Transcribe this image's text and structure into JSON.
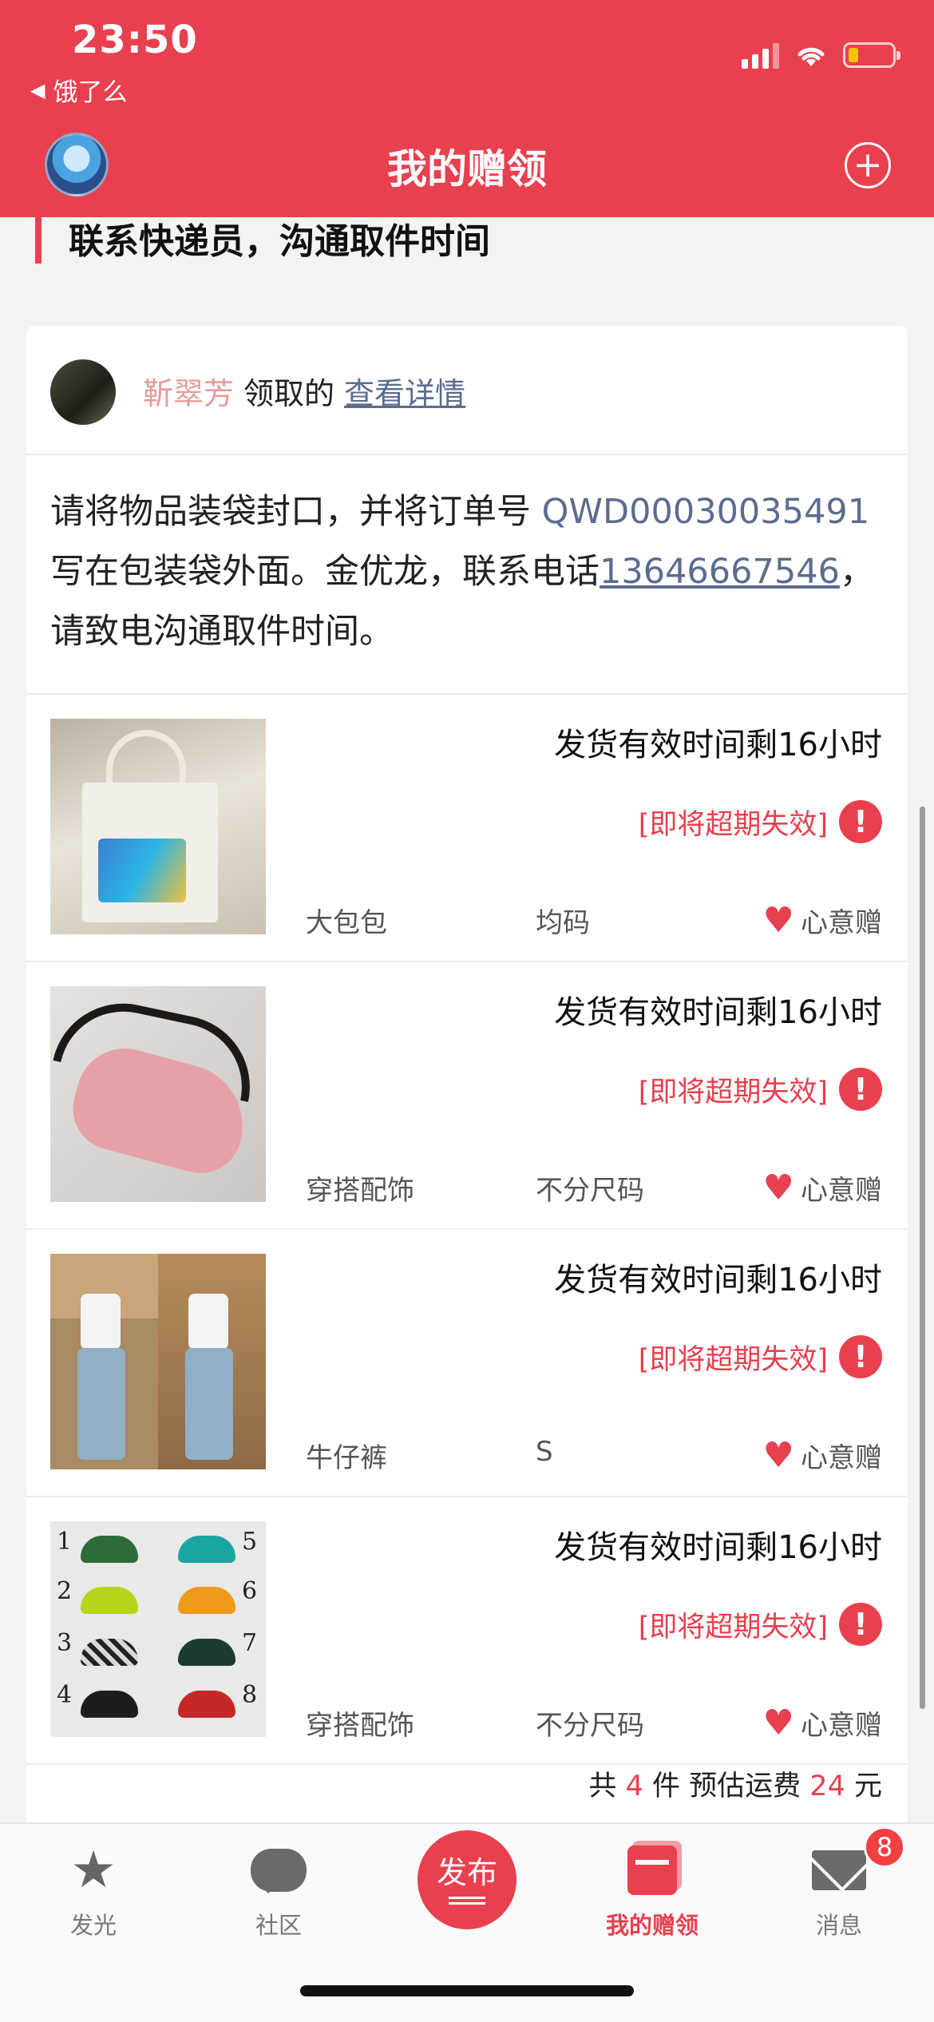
{
  "status_bar": {
    "time": "23:50",
    "back_app": "饿了么"
  },
  "header": {
    "title": "我的赠领",
    "add_symbol": "+"
  },
  "section": {
    "heading": "联系快递员，沟通取件时间"
  },
  "card": {
    "giver_name": "靳翠芳",
    "giver_verb": "领取的",
    "detail_link": "查看详情",
    "instructions": {
      "part1": "请将物品装袋封口，并将订单号 ",
      "order_no": "QWD00030035491",
      "part2": " 写在包装袋外面。金优龙，联系电话",
      "phone": "13646667546",
      "part3": "，请致电沟通取件时间。"
    },
    "items": [
      {
        "validity": "发货有效时间剩16小时",
        "warning": "[即将超期失效]",
        "category": "大包包",
        "size": "均码",
        "tag": "心意赠",
        "image": "tote-bag"
      },
      {
        "validity": "发货有效时间剩16小时",
        "warning": "[即将超期失效]",
        "category": "穿搭配饰",
        "size": "不分尺码",
        "tag": "心意赠",
        "image": "eye-mask"
      },
      {
        "validity": "发货有效时间剩16小时",
        "warning": "[即将超期失效]",
        "category": "牛仔裤",
        "size": "S",
        "tag": "心意赠",
        "image": "jeans"
      },
      {
        "validity": "发货有效时间剩16小时",
        "warning": "[即将超期失效]",
        "category": "穿搭配饰",
        "size": "不分尺码",
        "tag": "心意赠",
        "image": "hair-clips"
      }
    ],
    "total": {
      "prefix": "共",
      "count": "4",
      "mid": "件 预估运费",
      "fee": "24",
      "unit": "元"
    }
  },
  "tabbar": {
    "tabs": [
      {
        "label": "发光",
        "icon": "star-icon"
      },
      {
        "label": "社区",
        "icon": "chat-icon"
      },
      {
        "label": "我的赠领",
        "icon": "gift-icon"
      },
      {
        "label": "消息",
        "icon": "mail-icon"
      }
    ],
    "publish_label": "发布",
    "message_badge": "8"
  },
  "colors": {
    "accent": "#e8404f",
    "link": "#5b6c8f",
    "giver_name": "#e89a9a"
  },
  "clip_numbers": [
    "1",
    "2",
    "3",
    "4",
    "5",
    "6",
    "7",
    "8"
  ]
}
